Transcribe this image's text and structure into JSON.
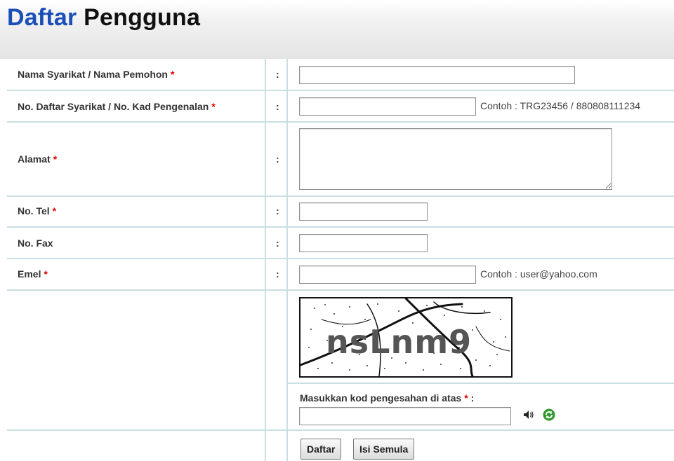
{
  "header": {
    "title_word1": "Daftar",
    "title_word2": "Pengguna"
  },
  "form": {
    "separator": ":",
    "required_mark": "*",
    "fields": {
      "nama": {
        "label": "Nama Syarikat / Nama Pemohon",
        "value": "",
        "required": true
      },
      "no_daftar": {
        "label": "No. Daftar Syarikat / No. Kad Pengenalan",
        "value": "",
        "required": true,
        "hint": "Contoh : TRG23456 / 880808111234"
      },
      "alamat": {
        "label": "Alamat",
        "value": "",
        "required": true
      },
      "tel": {
        "label": "No. Tel",
        "value": "",
        "required": true
      },
      "fax": {
        "label": "No. Fax",
        "value": "",
        "required": false
      },
      "emel": {
        "label": "Emel",
        "value": "",
        "required": true,
        "hint": "Contoh : user@yahoo.com"
      }
    },
    "captcha": {
      "image_text": "nsLnm9",
      "prompt": "Masukkan kod pengesahan di atas",
      "prompt_suffix": " :",
      "value": "",
      "audio_icon": "speaker-icon",
      "refresh_icon": "refresh-icon"
    },
    "buttons": {
      "submit": "Daftar",
      "reset": "Isi Semula"
    }
  },
  "colors": {
    "title_accent": "#1b4fb8",
    "required": "#e00000",
    "grid_line": "#c9dfe3",
    "refresh_green": "#2f9a2f"
  }
}
